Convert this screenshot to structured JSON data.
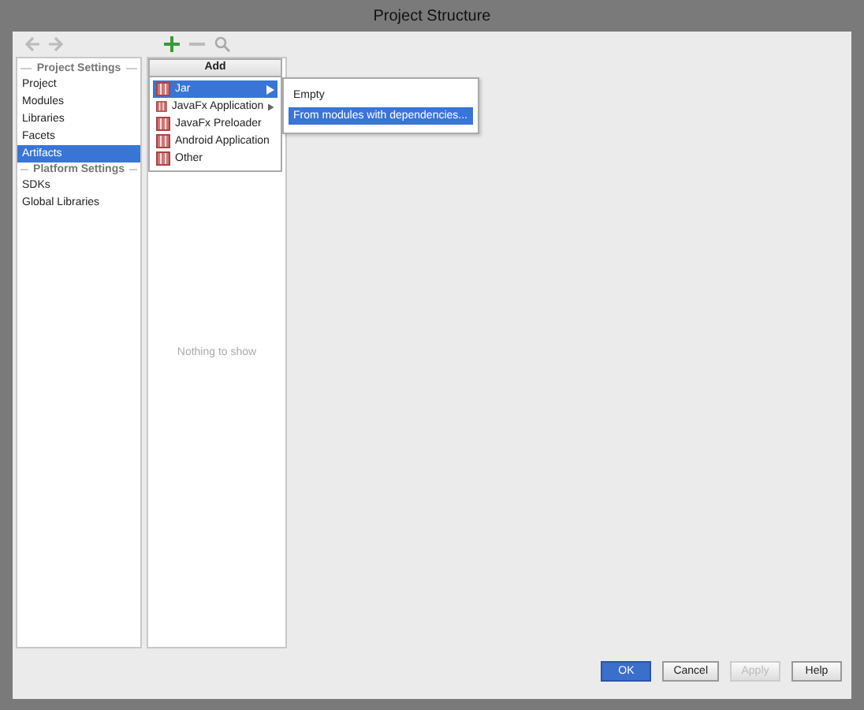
{
  "window": {
    "title": "Project Structure"
  },
  "sidebar": {
    "sections": [
      {
        "heading": "Project Settings",
        "items": [
          {
            "label": "Project",
            "selected": false
          },
          {
            "label": "Modules",
            "selected": false
          },
          {
            "label": "Libraries",
            "selected": false
          },
          {
            "label": "Facets",
            "selected": false
          },
          {
            "label": "Artifacts",
            "selected": true
          }
        ]
      },
      {
        "heading": "Platform Settings",
        "items": [
          {
            "label": "SDKs",
            "selected": false
          },
          {
            "label": "Global Libraries",
            "selected": false
          }
        ]
      }
    ]
  },
  "artifacts": {
    "empty_text": "Nothing to show"
  },
  "add_menu": {
    "title": "Add",
    "items": [
      {
        "label": "Jar",
        "selected": true,
        "submenu": true
      },
      {
        "label": "JavaFx Application",
        "selected": false,
        "submenu": true
      },
      {
        "label": "JavaFx Preloader",
        "selected": false,
        "submenu": false
      },
      {
        "label": "Android Application",
        "selected": false,
        "submenu": false
      },
      {
        "label": "Other",
        "selected": false,
        "submenu": false
      }
    ]
  },
  "submenu": {
    "items": [
      {
        "label": "Empty",
        "selected": false
      },
      {
        "label": "From modules with dependencies...",
        "selected": true
      }
    ]
  },
  "buttons": [
    {
      "label": "OK",
      "kind": "primary",
      "disabled": false
    },
    {
      "label": "Cancel",
      "kind": "normal",
      "disabled": false
    },
    {
      "label": "Apply",
      "kind": "normal",
      "disabled": true
    },
    {
      "label": "Help",
      "kind": "normal",
      "disabled": false
    }
  ]
}
